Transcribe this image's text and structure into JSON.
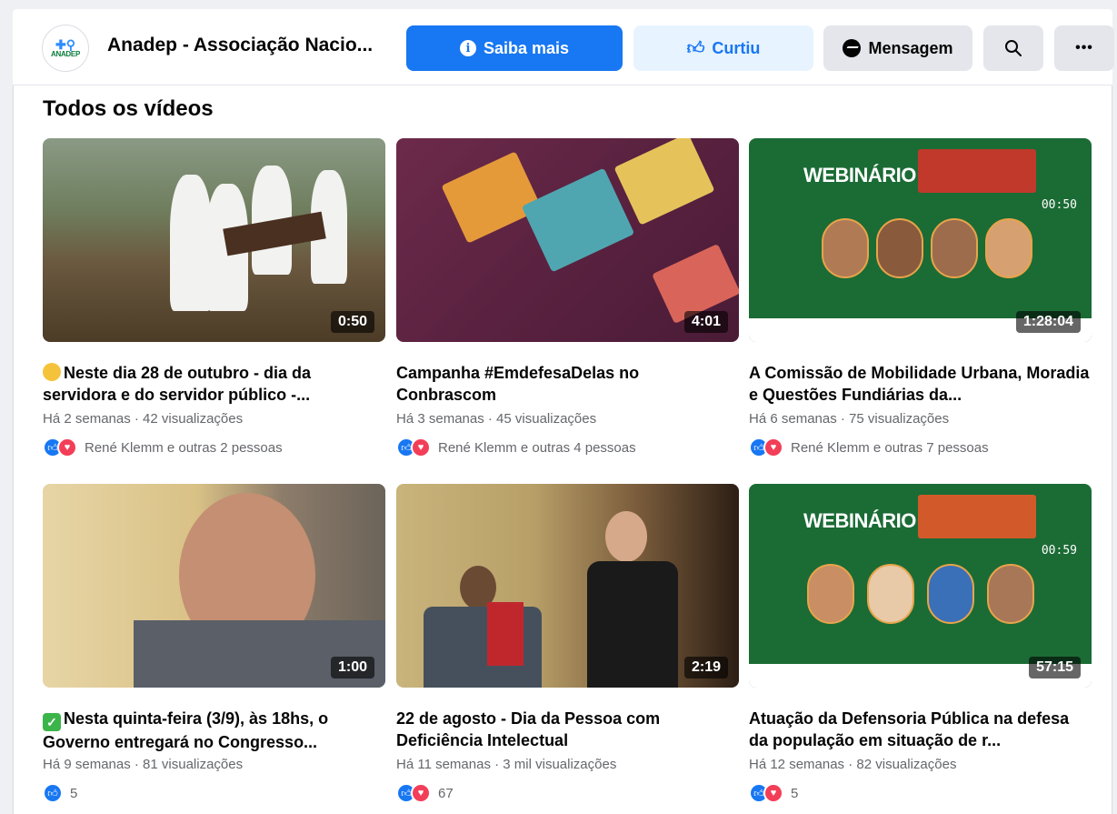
{
  "header": {
    "page_name": "Anadep - Associação Nacio...",
    "avatar_brand": "ANADEP",
    "buttons": {
      "learn_more": "Saiba mais",
      "liked": "Curtiu",
      "message": "Mensagem"
    }
  },
  "section": {
    "title": "Todos os vídeos"
  },
  "videos": [
    {
      "title": "Neste dia 28 de outubro - dia da servidora e do servidor público -...",
      "prefix_emoji": "smile",
      "duration": "0:50",
      "meta": "Há 2 semanas · 42 visualizações",
      "reactions_text": "René Klemm e outras 2 pessoas",
      "reaction_types": [
        "like",
        "love"
      ]
    },
    {
      "title": "Campanha #EmdefesaDelas no Conbrascom",
      "duration": "4:01",
      "meta": "Há 3 semanas · 45 visualizações",
      "reactions_text": "René Klemm e outras 4 pessoas",
      "reaction_types": [
        "like",
        "love"
      ]
    },
    {
      "title": "A Comissão de Mobilidade Urbana, Moradia e Questões Fundiárias da...",
      "duration": "1:28:04",
      "meta": "Há 6 semanas · 75 visualizações",
      "reactions_text": "René Klemm e outras 7 pessoas",
      "reaction_types": [
        "like",
        "love"
      ],
      "thumb_label": "WEBINÁRIO",
      "thumb_timer": "00:50"
    },
    {
      "title": "Nesta quinta-feira (3/9), às 18hs, o Governo entregará no Congresso...",
      "prefix_emoji": "check",
      "duration": "1:00",
      "meta": "Há 9 semanas · 81 visualizações",
      "reactions_text": "5",
      "reaction_types": [
        "like"
      ]
    },
    {
      "title": "22 de agosto - Dia da Pessoa com Deficiência Intelectual",
      "duration": "2:19",
      "meta": "Há 11 semanas · 3 mil visualizações",
      "reactions_text": "67",
      "reaction_types": [
        "like",
        "love"
      ]
    },
    {
      "title": "Atuação da Defensoria Pública na defesa da população em situação de r...",
      "duration": "57:15",
      "meta": "Há 12 semanas · 82 visualizações",
      "reactions_text": "5",
      "reaction_types": [
        "like",
        "love"
      ],
      "thumb_label": "WEBINÁRIO",
      "thumb_timer": "00:59"
    }
  ],
  "colors": {
    "primary": "#1877f2",
    "like_bg": "#e7f3ff",
    "secondary_bg": "#e4e6eb",
    "love": "#f33e58",
    "meta_text": "#65676b",
    "webinar_green": "#1b6b35"
  }
}
